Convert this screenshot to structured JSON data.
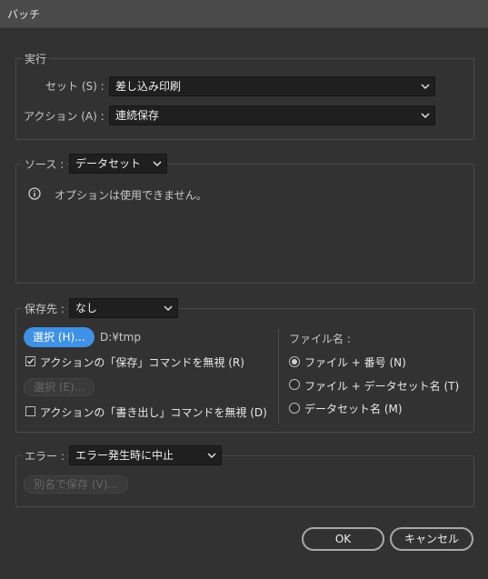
{
  "window": {
    "title": "バッチ"
  },
  "run": {
    "group_label": "実行",
    "set_label": "セット (S) :",
    "set_value": "差し込み印刷",
    "action_label": "アクション (A) :",
    "action_value": "連続保存"
  },
  "source": {
    "label": "ソース :",
    "value": "データセット",
    "info_text": "オプションは使用できません。"
  },
  "destination": {
    "label": "保存先 :",
    "value": "なし",
    "choose_button": "選択 (H)...",
    "path": "D:¥tmp",
    "override_save_label": "アクションの「保存」コマンドを無視 (R)",
    "override_save_checked": true,
    "choose_disabled_button": "選択 (E)...",
    "override_export_label": "アクションの「書き出し」コマンドを無視 (D)",
    "override_export_checked": false,
    "file_name_label": "ファイル名 :",
    "naming_options": [
      {
        "label": "ファイル + 番号 (N)",
        "selected": true
      },
      {
        "label": "ファイル + データセット名 (T)",
        "selected": false
      },
      {
        "label": "データセット名 (M)",
        "selected": false
      }
    ]
  },
  "errors": {
    "label": "エラー :",
    "value": "エラー発生時に中止",
    "save_as_button": "別名で保存 (V)..."
  },
  "footer": {
    "ok": "OK",
    "cancel": "キャンセル"
  },
  "colors": {
    "accent": "#3e91e4",
    "background": "#323232",
    "field": "#1f1f1f"
  }
}
